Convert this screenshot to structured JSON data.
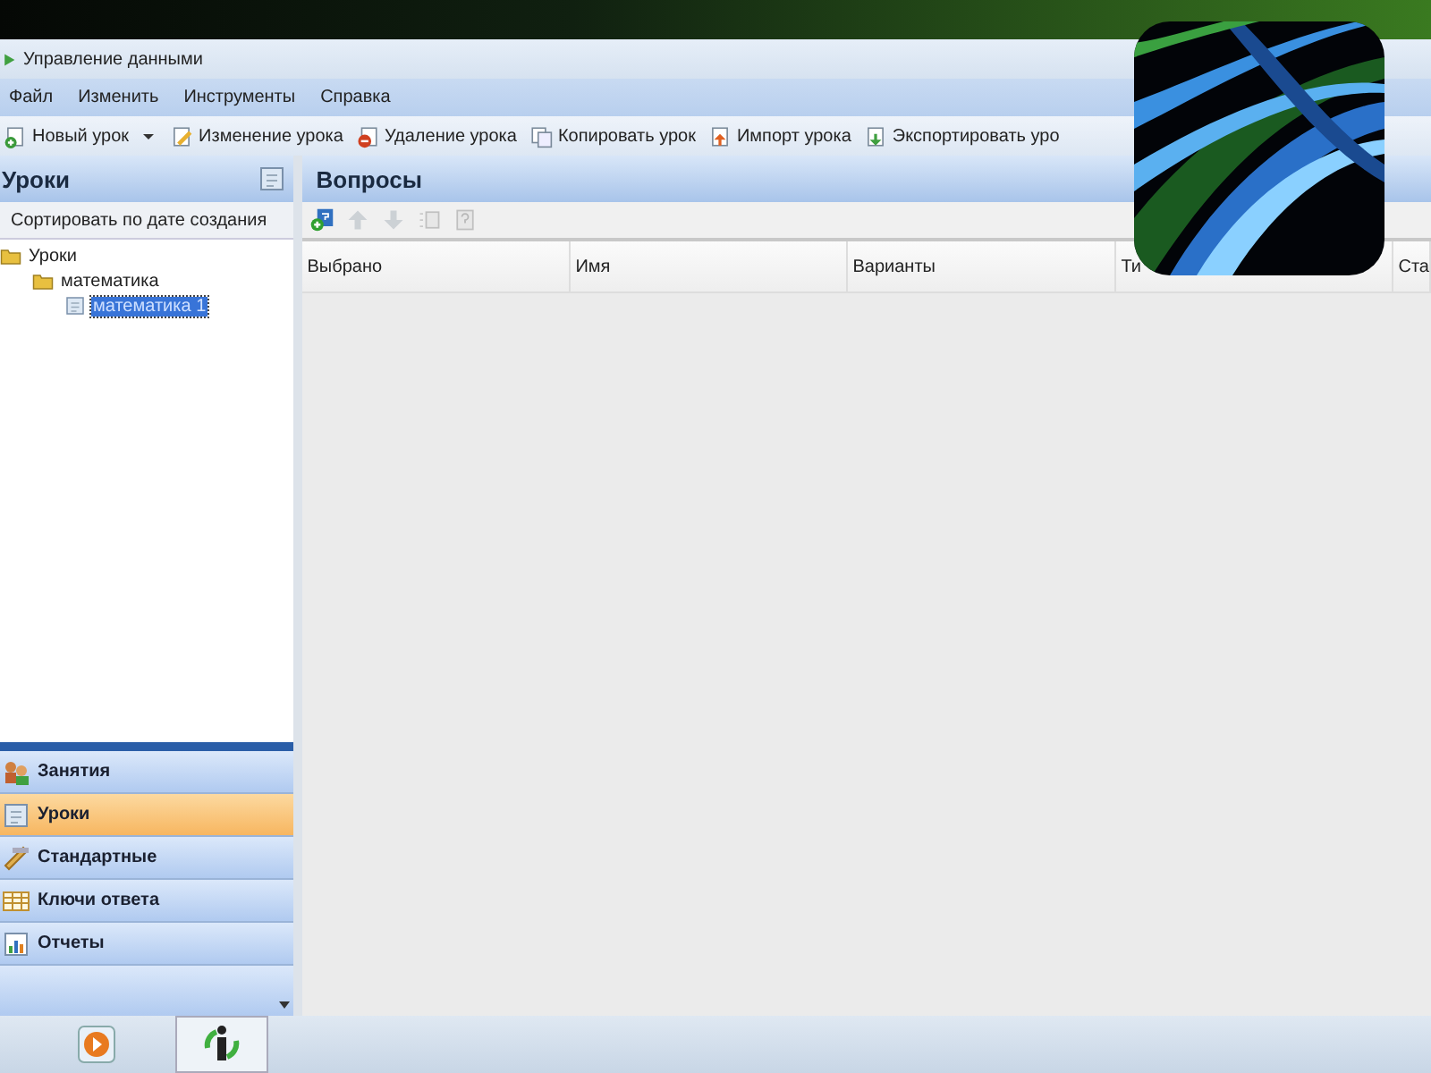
{
  "window": {
    "title": "Управление данными"
  },
  "menu": [
    "Файл",
    "Изменить",
    "Инструменты",
    "Справка"
  ],
  "toolbar": [
    {
      "label": "Новый урок",
      "kind": "new",
      "dropdown": true
    },
    {
      "label": "Изменение урока",
      "kind": "edit",
      "dropdown": false
    },
    {
      "label": "Удаление урока",
      "kind": "delete",
      "dropdown": false
    },
    {
      "label": "Копировать урок",
      "kind": "copy",
      "dropdown": false
    },
    {
      "label": "Импорт урока",
      "kind": "import",
      "dropdown": false
    },
    {
      "label": "Экспортировать уро",
      "kind": "export",
      "dropdown": false
    }
  ],
  "left_panel": {
    "title": "Уроки",
    "sort_label": "Сортировать по дате создания",
    "tree": [
      {
        "label": "Уроки",
        "kind": "folder",
        "selected": false,
        "children": [
          {
            "label": "математика",
            "kind": "folder",
            "selected": false,
            "children": [
              {
                "label": "математика 1",
                "kind": "doc",
                "selected": true
              }
            ]
          }
        ]
      }
    ],
    "nav": [
      {
        "label": "Занятия",
        "kind": "people",
        "selected": false
      },
      {
        "label": "Уроки",
        "kind": "doc",
        "selected": true
      },
      {
        "label": "Стандартные",
        "kind": "ruler",
        "selected": false
      },
      {
        "label": "Ключи ответа",
        "kind": "grid",
        "selected": false
      },
      {
        "label": "Отчеты",
        "kind": "chart",
        "selected": false
      }
    ]
  },
  "questions": {
    "title": "Вопросы",
    "tools": [
      {
        "kind": "add",
        "disabled": false
      },
      {
        "kind": "up",
        "disabled": true
      },
      {
        "kind": "down",
        "disabled": true
      },
      {
        "kind": "list",
        "disabled": true
      },
      {
        "kind": "help",
        "disabled": true
      }
    ],
    "columns": [
      "Выбрано",
      "Имя",
      "Варианты",
      "Ти",
      "Ста"
    ]
  },
  "taskbar": [
    {
      "kind": "play",
      "selected": false
    },
    {
      "kind": "info",
      "selected": true
    }
  ],
  "overlay": {
    "kind": "picture"
  }
}
